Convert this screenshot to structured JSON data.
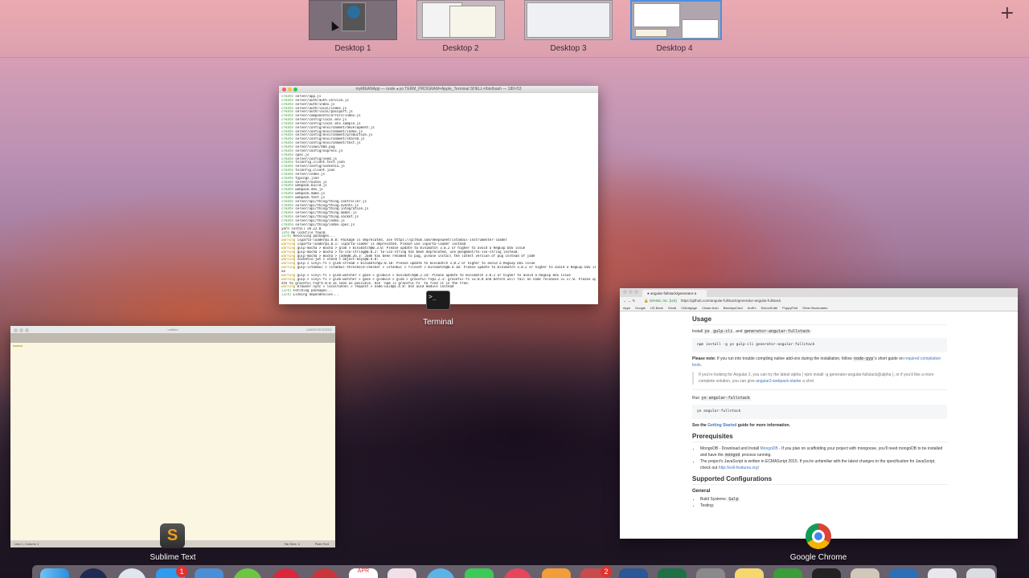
{
  "spaces": {
    "desktops": [
      {
        "label": "Desktop 1"
      },
      {
        "label": "Desktop 2"
      },
      {
        "label": "Desktop 3"
      },
      {
        "label": "Desktop 4"
      }
    ],
    "add_label": "+"
  },
  "terminal": {
    "title": "myMEANApp — node ◂ yo TERM_PROGRAM=Apple_Terminal SHELL=/bin/bash — 180×53",
    "app_label": "Terminal",
    "lines": [
      {
        "tag": "create",
        "text": "server/app.js"
      },
      {
        "tag": "create",
        "text": "server/auth/auth.service.js"
      },
      {
        "tag": "create",
        "text": "server/auth/index.js"
      },
      {
        "tag": "create",
        "text": "server/auth/local/index.js"
      },
      {
        "tag": "create",
        "text": "server/auth/local/passport.js"
      },
      {
        "tag": "create",
        "text": "server/components/errors/index.js"
      },
      {
        "tag": "create",
        "text": "server/config/local.env.js"
      },
      {
        "tag": "create",
        "text": "server/config/local.env.sample.js"
      },
      {
        "tag": "create",
        "text": "server/config/environment/development.js"
      },
      {
        "tag": "create",
        "text": "server/config/environment/index.js"
      },
      {
        "tag": "create",
        "text": "server/config/environment/production.js"
      },
      {
        "tag": "create",
        "text": "server/config/environment/shared.js"
      },
      {
        "tag": "create",
        "text": "server/config/environment/test.js"
      },
      {
        "tag": "create",
        "text": "server/views/404.pug"
      },
      {
        "tag": "create",
        "text": "server/config/express.js"
      },
      {
        "tag": "create",
        "text": "spec.js"
      },
      {
        "tag": "create",
        "text": "server/config/seed.js"
      },
      {
        "tag": "create",
        "text": "tsconfig.client.test.json"
      },
      {
        "tag": "create",
        "text": "server/config/socketio.js"
      },
      {
        "tag": "create",
        "text": "tsconfig.client.json"
      },
      {
        "tag": "create",
        "text": "server/index.js"
      },
      {
        "tag": "create",
        "text": "typings.json"
      },
      {
        "tag": "create",
        "text": "server/routes.js"
      },
      {
        "tag": "create",
        "text": "webpack.build.js"
      },
      {
        "tag": "create",
        "text": "webpack.dev.js"
      },
      {
        "tag": "create",
        "text": "webpack.make.js"
      },
      {
        "tag": "create",
        "text": "webpack.test.js"
      },
      {
        "tag": "create",
        "text": "server/api/thing/thing.controller.js"
      },
      {
        "tag": "create",
        "text": "server/api/thing/thing.events.js"
      },
      {
        "tag": "create",
        "text": "server/api/thing/thing.integration.js"
      },
      {
        "tag": "create",
        "text": "server/api/thing/thing.model.js"
      },
      {
        "tag": "create",
        "text": "server/api/thing/thing.socket.js"
      },
      {
        "tag": "create",
        "text": "server/api/thing/index.js"
      },
      {
        "tag": "create",
        "text": "server/api/thing/index.spec.js"
      },
      {
        "tag": "",
        "text": "yarn install v0.22.0"
      },
      {
        "tag": "info",
        "text": "No lockfile found."
      },
      {
        "tag": "[1/4]",
        "text": "Resolving packages..."
      },
      {
        "tag": "warning",
        "text": "isparta-loader@1.0.0: Package is deprecated, use https://github.com/deepsweet/istanbul-instrumenter-loader"
      },
      {
        "tag": "warning",
        "text": "isparta-loader@1.0.1: isparta-loader is deprecated. Please use isparta-loader instead"
      },
      {
        "tag": "warning",
        "text": "gulp-mocha > mocha > glob > minimatch@0.3.0: Please update to minimatch 3.0.2 or higher to avoid a RegExp DoS issue"
      },
      {
        "tag": "warning",
        "text": "gulp-mocha > mocha > to-iso-string@0.0.2: to-iso-string has been deprecated, use @segment/to-iso-string instead."
      },
      {
        "tag": "warning",
        "text": "gulp-mocha > mocha > jade@0.26.3: Jade has been renamed to pug, please install the latest version of pug instead of jade"
      },
      {
        "tag": "warning",
        "text": "socketio-jwt > xtend > object-keys@0.4.0: ..."
      },
      {
        "tag": "warning",
        "text": "gulp > vinyl-fs > glob-stream > minimatch@2.0.10: Please update to minimatch 3.0.2 or higher to avoid a RegExp DoS issue"
      },
      {
        "tag": "warning",
        "text": "gulp-istanbul > istanbul-threshold-checker > istanbul > fileset > minimatch@0.4.10: Please update to minimatch 3.0.2 or higher to avoid a RegExp DoS iss"
      },
      {
        "tag": "",
        "text": "ue"
      },
      {
        "tag": "",
        "text": ""
      },
      {
        "tag": "warning",
        "text": "gulp > vinyl-fs > glob-watcher > gaze > globule > minimatch@0.2.14: Please update to minimatch 3.0.2 or higher to avoid a RegExp DoS issue"
      },
      {
        "tag": "warning",
        "text": "gulp > vinyl-fs > glob-watcher > gaze > globule > glob > graceful-fs@1.2.3: graceful-fs v3.0.0 and before will fail on node releases >= v7.0. Please upd"
      },
      {
        "tag": "",
        "text": "ate to graceful-fs@^4.0.0 as soon as possible. Use 'npm ls graceful-fs' to find it in the tree."
      },
      {
        "tag": "warning",
        "text": "browser-sync > localtunnel > request > node-uuid@1.4.8: Use uuid module instead"
      },
      {
        "tag": "[2/4]",
        "text": "Fetching packages..."
      },
      {
        "tag": "[3/4]",
        "text": "Linking dependencies..."
      }
    ]
  },
  "sublime": {
    "title": "untitled",
    "unregistered": "UNREGISTERED",
    "status_left": "Line 1, Column 1",
    "status_tab": "Tab Size: 4",
    "status_syntax": "Plain Text",
    "app_label": "Sublime Text"
  },
  "chrome": {
    "tab_title": "angular-fullstack/generator-a",
    "url_prefix": "GitHub, Inc. [US]",
    "url": "https://github.com/angular-fullstack/generator-angular-fullstack",
    "bookmarks": [
      "Apps",
      "Google",
      "US Bank",
      "Gmail",
      "CMortgage",
      "Chase Auto",
      "BarclaysCard",
      "AmEx",
      "SchoolCafé",
      "PuppyFind",
      "Other Bookmarks"
    ],
    "app_label": "Google Chrome",
    "content": {
      "usage_heading": "Usage",
      "install_prefix": "Install ",
      "install_pkg1": "yo",
      "install_pkg2": "gulp-cli",
      "install_and": ", and ",
      "install_pkg3": "generator-angular-fullstack",
      "install_cmd": "npm install -g yo gulp-cli generator-angular-fullstack",
      "note_bold": "Please note:",
      "note_text": " If you run into trouble compiling native add-ons during the installation, follow ",
      "note_code": "node-gyp",
      "note_text2": "'s short guide on ",
      "note_link": "required compilation tools",
      "quote_text": "If you're looking for Angular 2, you can try the latest alpha ( npm install -g generator-angular-fullstack@alpha ), or if you'd like a more complete solution, you can give ",
      "quote_link": "angular2-webpack-starter",
      "quote_end": " a shot.",
      "run_prefix": "Run ",
      "run_code": "yo angular-fullstack",
      "run_cmd": "yo angular-fullstack",
      "see_prefix": "See the ",
      "see_link": "Getting Started",
      "see_suffix": " guide for more information.",
      "prereq_heading": "Prerequisites",
      "prereq_1_prefix": "MongoDB - Download and Install ",
      "prereq_1_link": "MongoDB",
      "prereq_1_text": " - If you plan on scaffolding your project with mongoose, you'll need mongoDB to be installed and have the ",
      "prereq_1_code": "mongod",
      "prereq_1_end": " process running.",
      "prereq_2": "The project's JavaScript is written in ECMAScript 2015. If you're unfamiliar with the latest changes to the specification for JavaScript, check out ",
      "prereq_2_link": "http://es6-features.org/",
      "supported_heading": "Supported Configurations",
      "general_heading": "General",
      "build_label": "Build Systems: ",
      "build_value": "Gulp",
      "testing_label": "Testing:"
    }
  },
  "dock": {
    "badges": [
      "1",
      "2"
    ],
    "calendar_month": "APR"
  },
  "colors": {
    "accent": "#4a90e2",
    "terminal_create": "#2e8b2e",
    "link": "#4078c0"
  }
}
